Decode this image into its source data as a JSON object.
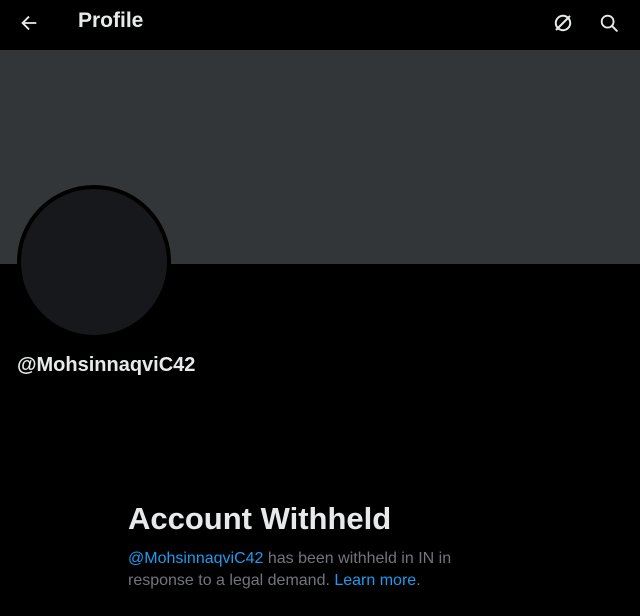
{
  "header": {
    "title": "Profile",
    "back_icon": "arrow-left-icon",
    "no_sync_icon": "slashed-circle-icon",
    "search_icon": "search-icon"
  },
  "profile": {
    "handle": "@MohsinnaqviC42",
    "banner_color": "#333639",
    "avatar_color": "#16181c"
  },
  "withheld": {
    "title": "Account Withheld",
    "handle_link": "@MohsinnaqviC42",
    "message_part1": " has been withheld in IN in response to a legal demand. ",
    "learn_more": "Learn more",
    "period": "."
  },
  "colors": {
    "background": "#000000",
    "text_primary": "#e7e9ea",
    "text_secondary": "#71767b",
    "link": "#1d9bf0"
  }
}
